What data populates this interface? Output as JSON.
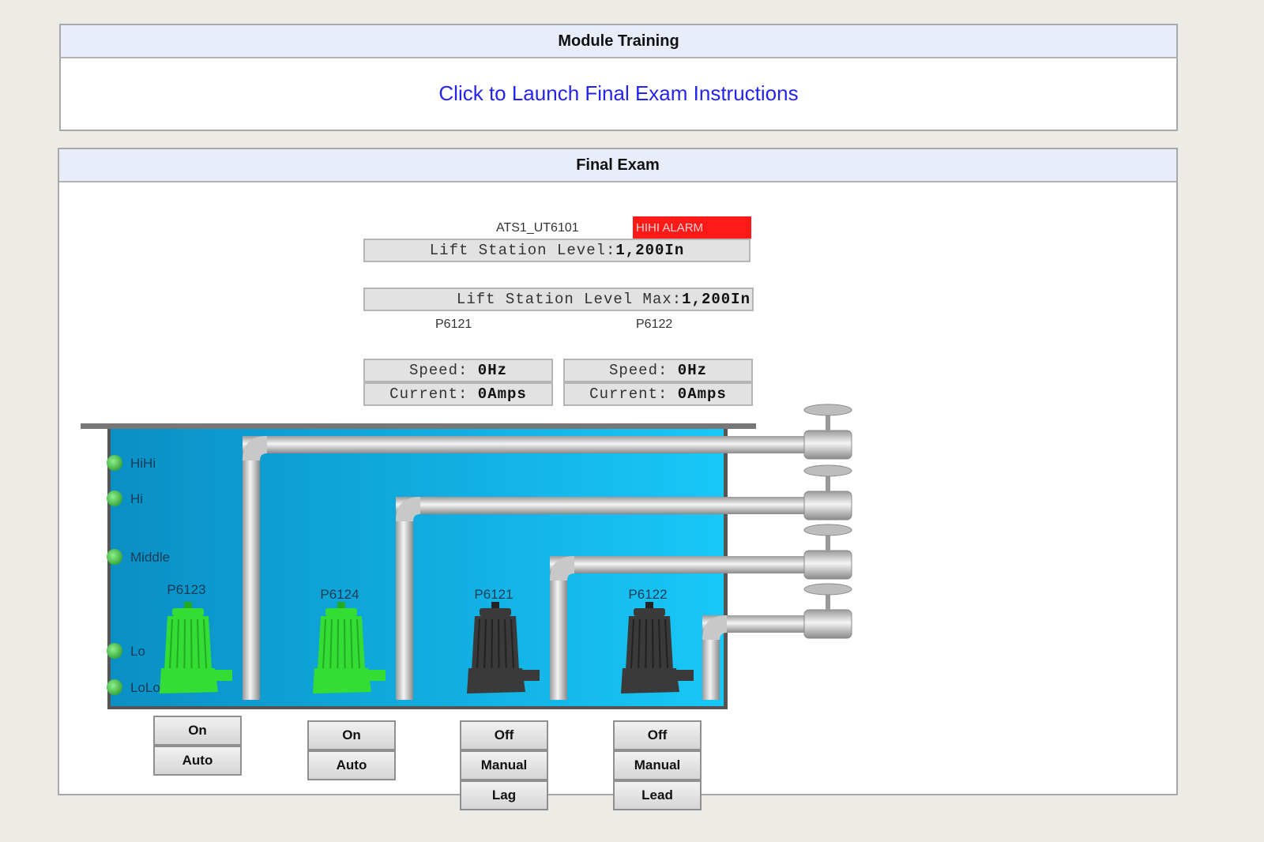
{
  "training": {
    "title": "Module Training",
    "launch_link": "Click to Launch Final Exam Instructions"
  },
  "exam": {
    "title": "Final Exam",
    "tag_name": "ATS1_UT6101",
    "alarm": "HIHI ALARM",
    "level_label": "Lift Station Level:",
    "level_value": "1,200In",
    "level_max_label": "Lift Station Level Max:",
    "level_max_value": "1,200In",
    "pump_readouts": [
      {
        "name": "P6121",
        "speed_label": "Speed:",
        "speed_value": "0Hz",
        "current_label": "Current:",
        "current_value": "0Amps"
      },
      {
        "name": "P6122",
        "speed_label": "Speed:",
        "speed_value": "0Hz",
        "current_label": "Current:",
        "current_value": "0Amps"
      }
    ],
    "level_switches": [
      {
        "label": "HiHi",
        "status": "active"
      },
      {
        "label": "Hi",
        "status": "active"
      },
      {
        "label": "Middle",
        "status": "active"
      },
      {
        "label": "Lo",
        "status": "active"
      },
      {
        "label": "LoLo",
        "status": "active"
      }
    ],
    "pumps": [
      {
        "name": "P6123",
        "running": true,
        "state": "On",
        "mode": "Auto"
      },
      {
        "name": "P6124",
        "running": true,
        "state": "On",
        "mode": "Auto"
      },
      {
        "name": "P6121",
        "running": false,
        "state": "Off",
        "mode": "Manual",
        "role": "Lag"
      },
      {
        "name": "P6122",
        "running": false,
        "state": "Off",
        "mode": "Manual",
        "role": "Lead"
      }
    ]
  },
  "colors": {
    "alarm": "#ff1a1a",
    "pump_running": "#33dd33",
    "pump_stopped": "#3a3a3a",
    "level_indicator": "#4cc44c",
    "wet_well_water": "#0aa8e0",
    "link": "#2424ee",
    "header_bg": "#e8ecfb"
  }
}
